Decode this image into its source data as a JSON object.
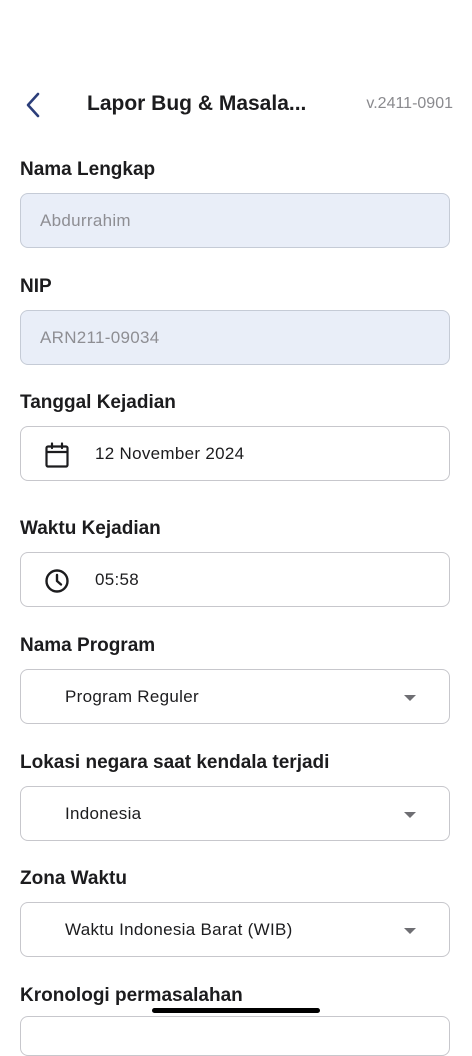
{
  "header": {
    "back_icon": "chevron-left-icon",
    "title": "Lapor Bug & Masala...",
    "version": "v.2411-0901",
    "accent_color": "#2c3e7a"
  },
  "form": {
    "name": {
      "label": "Nama Lengkap",
      "value": "Abdurrahim"
    },
    "nip": {
      "label": "NIP",
      "value": "ARN211-09034"
    },
    "incident_date": {
      "label": "Tanggal Kejadian",
      "icon": "calendar-icon",
      "value": "12 November 2024"
    },
    "incident_time": {
      "label": "Waktu Kejadian",
      "icon": "clock-icon",
      "value": "05:58"
    },
    "program": {
      "label": "Nama Program",
      "selected": "Program Reguler"
    },
    "country": {
      "label": "Lokasi negara saat kendala terjadi",
      "selected": "Indonesia"
    },
    "timezone": {
      "label": "Zona Waktu",
      "selected": "Waktu Indonesia Barat (WIB)"
    },
    "chronology": {
      "label": "Kronologi permasalahan"
    }
  }
}
